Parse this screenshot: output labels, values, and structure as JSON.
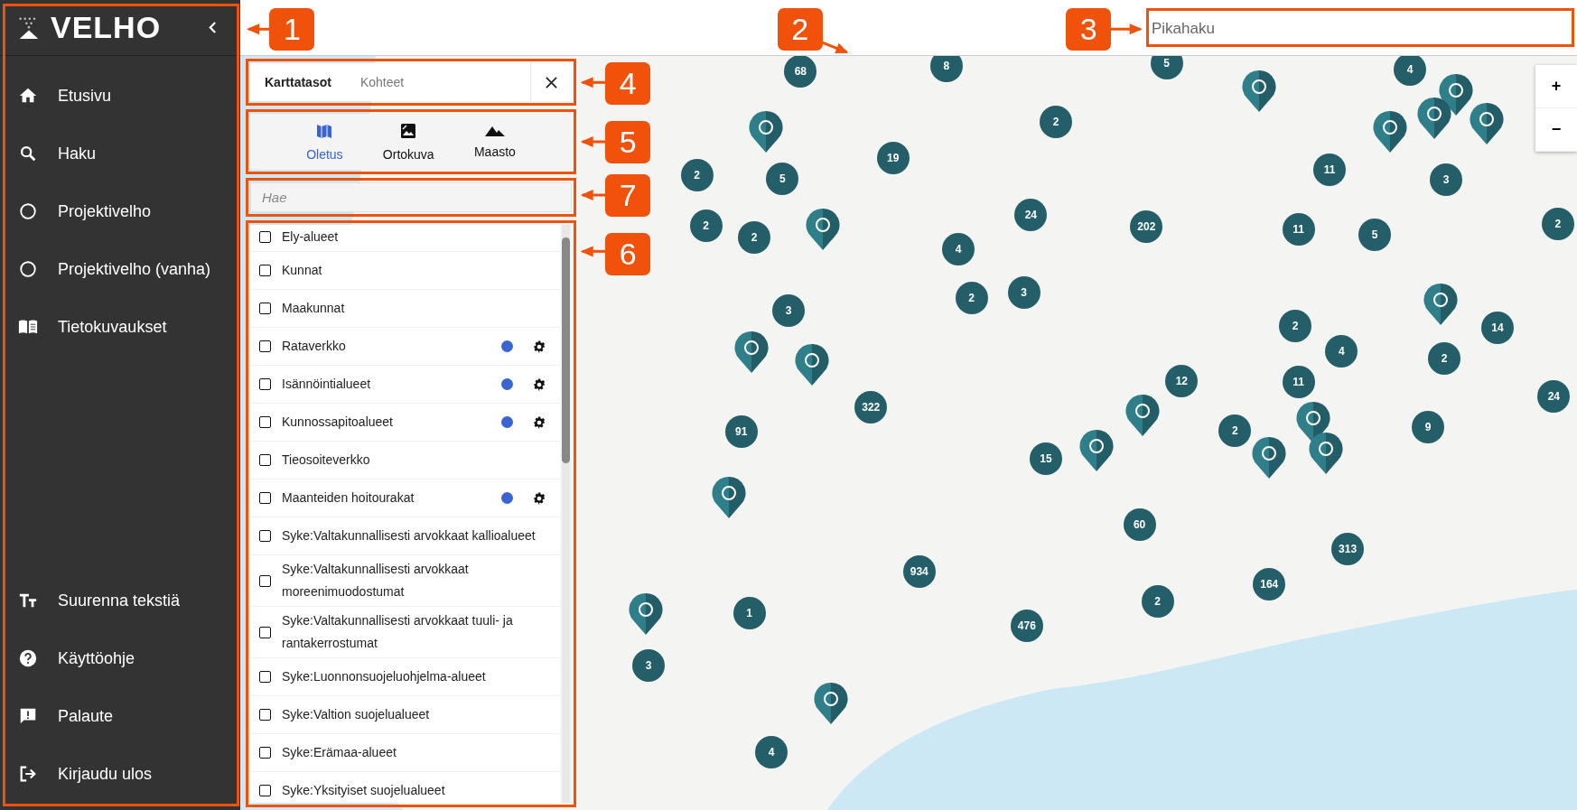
{
  "sidebar": {
    "logo": "VELHO",
    "items": [
      {
        "label": "Etusivu"
      },
      {
        "label": "Haku"
      },
      {
        "label": "Projektivelho"
      },
      {
        "label": "Projektivelho (vanha)"
      },
      {
        "label": "Tietokuvaukset"
      }
    ],
    "bottom_items": [
      {
        "label": "Suurenna tekstiä"
      },
      {
        "label": "Käyttöohje"
      },
      {
        "label": "Palaute"
      },
      {
        "label": "Kirjaudu ulos"
      }
    ]
  },
  "search": {
    "placeholder": "Pikahaku"
  },
  "panel": {
    "tabs": [
      {
        "label": "Karttatasot",
        "selected": true
      },
      {
        "label": "Kohteet",
        "selected": false
      }
    ],
    "basemaps": [
      {
        "label": "Oletus",
        "selected": true
      },
      {
        "label": "Ortokuva",
        "selected": false
      },
      {
        "label": "Maasto",
        "selected": false
      }
    ],
    "filter": {
      "placeholder": "Hae"
    },
    "layers": [
      {
        "label": "Ely-alueet",
        "checked": false
      },
      {
        "label": "Kunnat",
        "checked": false
      },
      {
        "label": "Maakunnat",
        "checked": false
      },
      {
        "label": "Rataverkko",
        "checked": false,
        "color": "#3a64d2"
      },
      {
        "label": "Isännöintialueet",
        "checked": false,
        "color": "#3a64d2"
      },
      {
        "label": "Kunnossapitoalueet",
        "checked": false,
        "color": "#3a64d2"
      },
      {
        "label": "Tieosoiteverkko",
        "checked": false
      },
      {
        "label": "Maanteiden hoitourakat",
        "checked": false,
        "color": "#3a64d2"
      },
      {
        "label": "Syke:Valtakunnallisesti arvokkaat kallioalueet",
        "checked": false
      },
      {
        "label": "Syke:Valtakunnallisesti arvokkaat moreenimuodostumat",
        "checked": false
      },
      {
        "label": "Syke:Valtakunnallisesti arvokkaat tuuli- ja rantakerrostumat",
        "checked": false
      },
      {
        "label": "Syke:Luonnonsuojeluohjelma-alueet",
        "checked": false
      },
      {
        "label": "Syke:Valtion suojelualueet",
        "checked": false
      },
      {
        "label": "Syke:Erämaa-alueet",
        "checked": false
      },
      {
        "label": "Syke:Yksityiset suojelualueet",
        "checked": false
      }
    ]
  },
  "map": {
    "zoom": [
      "+",
      "−"
    ],
    "clusters": [
      {
        "count": "68"
      },
      {
        "count": "8"
      },
      {
        "count": "5"
      },
      {
        "count": "4"
      },
      {
        "count": "2"
      },
      {
        "count": "2"
      },
      {
        "count": "5"
      },
      {
        "count": "19"
      },
      {
        "count": "11"
      },
      {
        "count": "3"
      },
      {
        "count": "2"
      },
      {
        "count": "2"
      },
      {
        "count": "4"
      },
      {
        "count": "24"
      },
      {
        "count": "202"
      },
      {
        "count": "11"
      },
      {
        "count": "5"
      },
      {
        "count": "2"
      },
      {
        "count": "91"
      },
      {
        "count": "3"
      },
      {
        "count": "322"
      },
      {
        "count": "2"
      },
      {
        "count": "3"
      },
      {
        "count": "15"
      },
      {
        "count": "12"
      },
      {
        "count": "2"
      },
      {
        "count": "2"
      },
      {
        "count": "11"
      },
      {
        "count": "4"
      },
      {
        "count": "9"
      },
      {
        "count": "2"
      },
      {
        "count": "14"
      },
      {
        "count": "24"
      },
      {
        "count": "1"
      },
      {
        "count": "934"
      },
      {
        "count": "476"
      },
      {
        "count": "60"
      },
      {
        "count": "2"
      },
      {
        "count": "164"
      },
      {
        "count": "313"
      },
      {
        "count": "3"
      },
      {
        "count": "4"
      }
    ]
  },
  "annotations": [
    {
      "label": "1"
    },
    {
      "label": "2"
    },
    {
      "label": "3"
    },
    {
      "label": "4"
    },
    {
      "label": "5"
    },
    {
      "label": "7"
    },
    {
      "label": "6"
    }
  ]
}
